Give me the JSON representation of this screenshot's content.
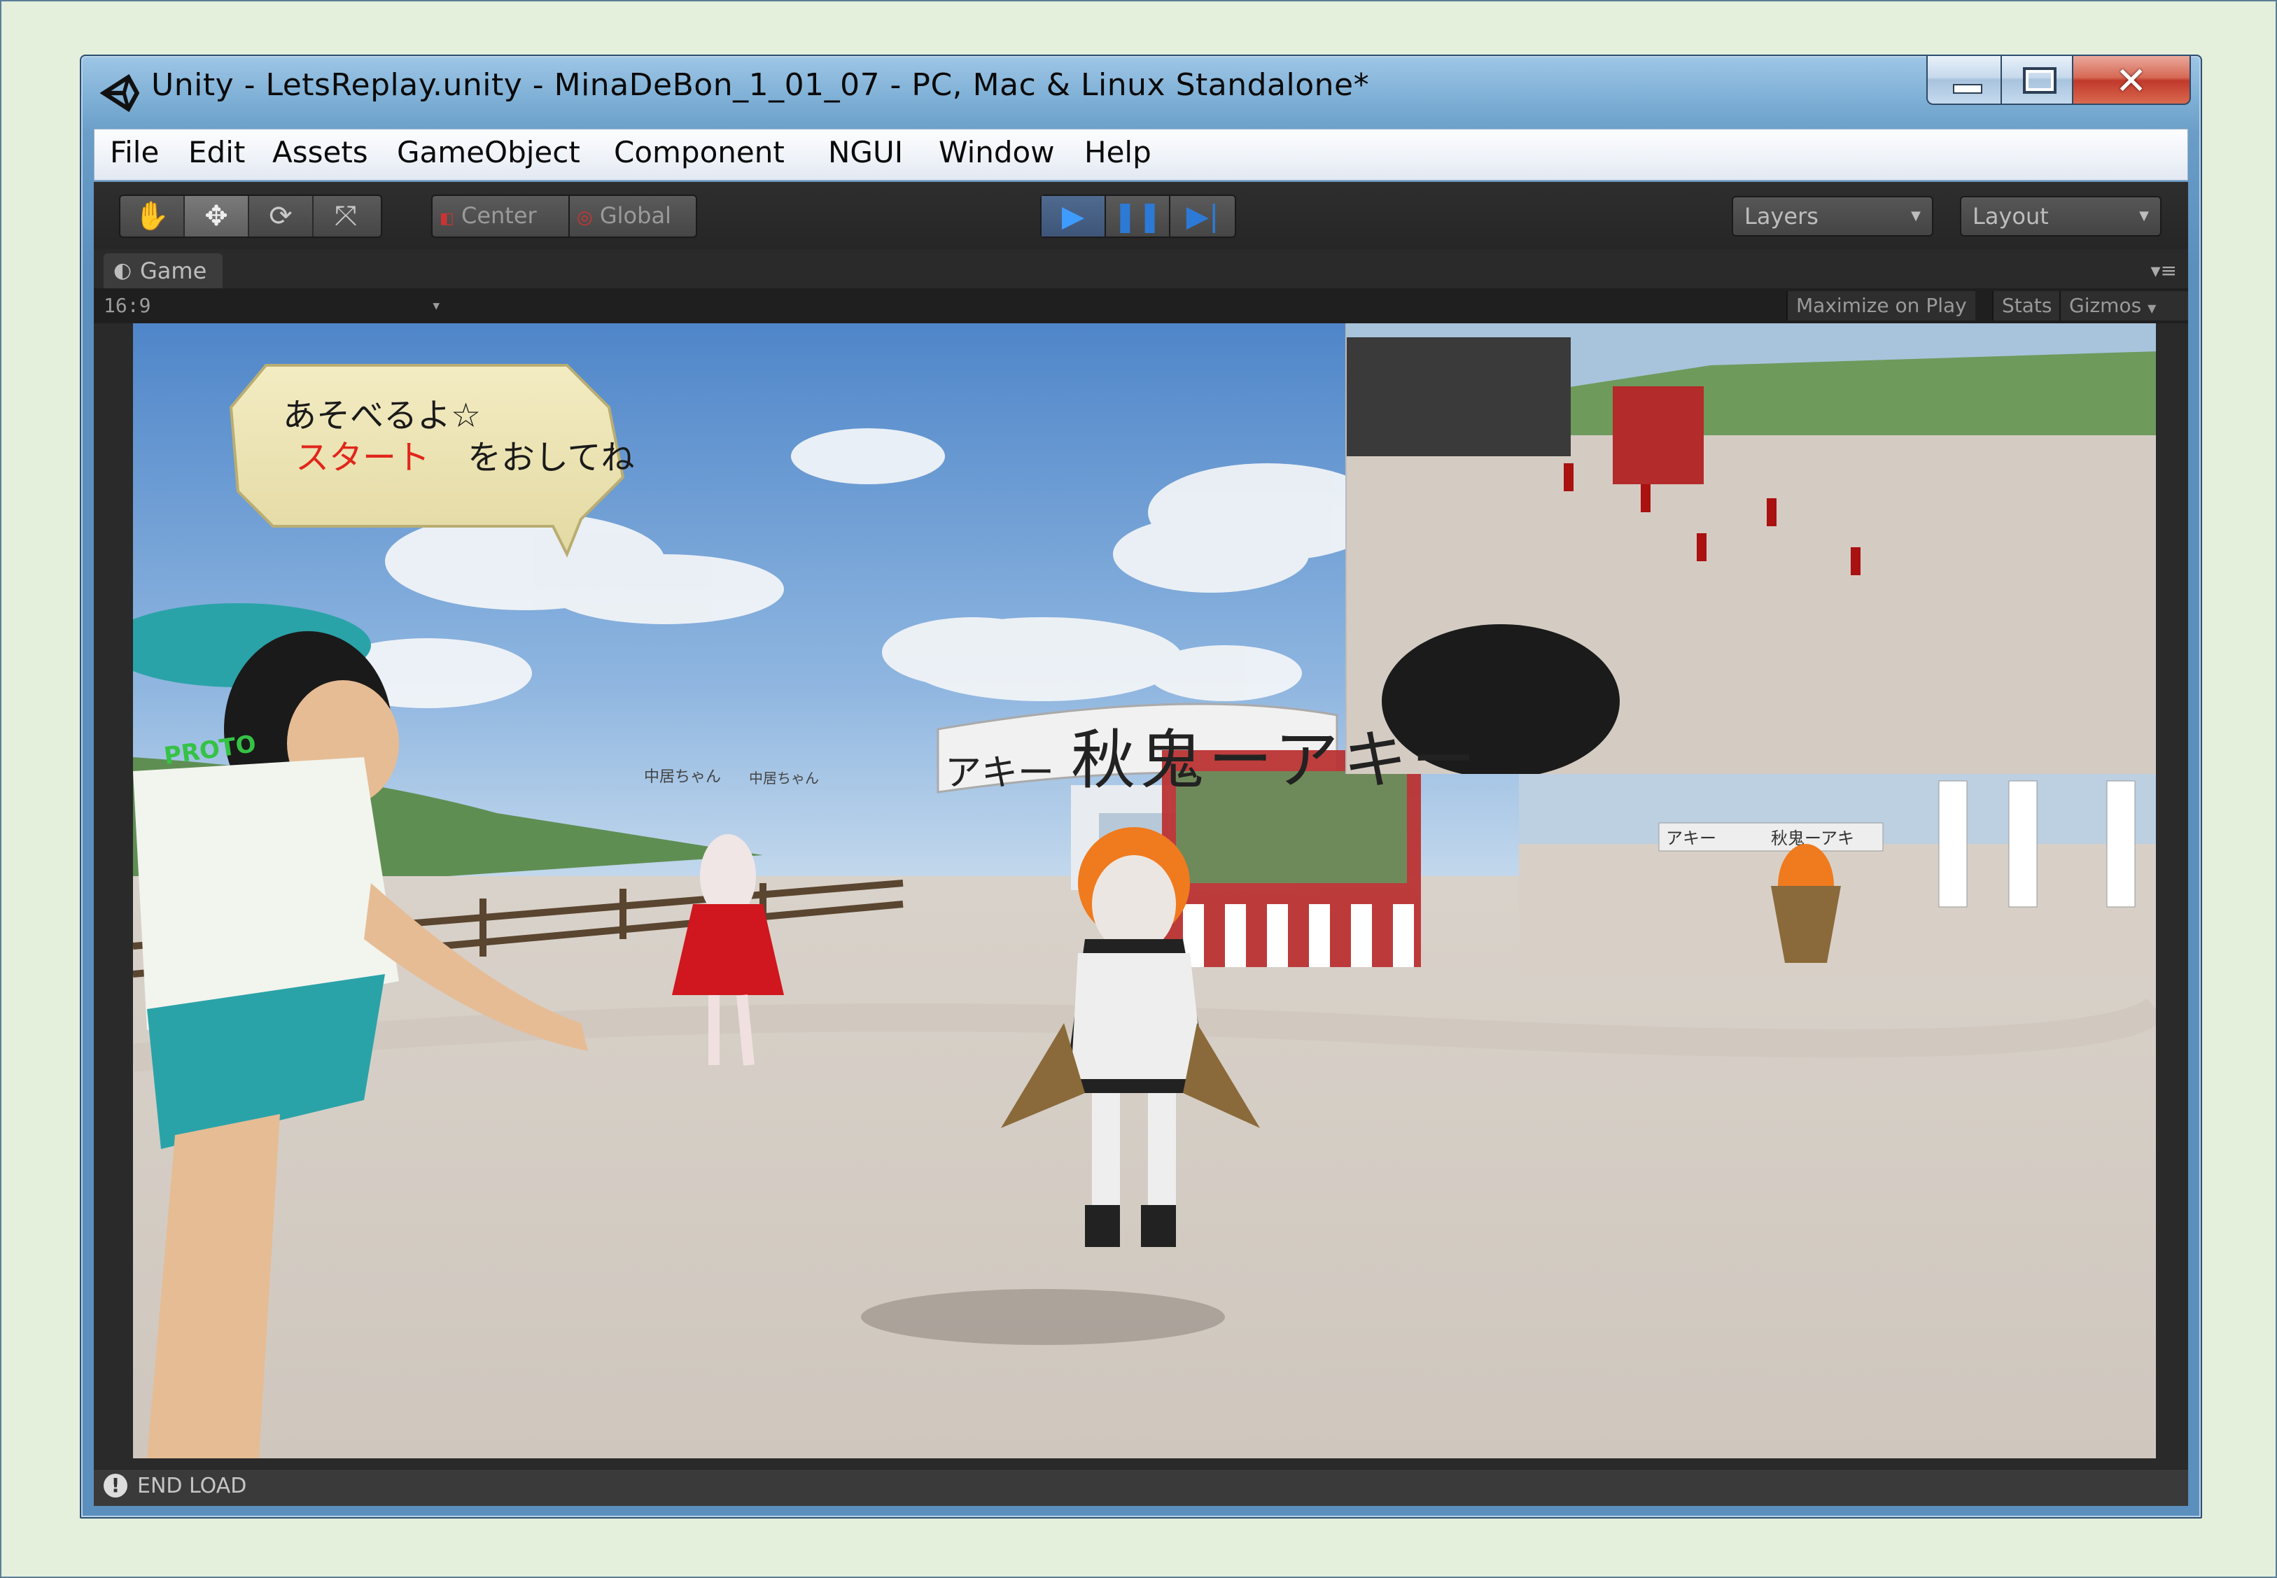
{
  "window": {
    "title": "Unity - LetsReplay.unity - MinaDeBon_1_01_07 - PC, Mac & Linux Standalone*"
  },
  "menu": {
    "items": [
      "File",
      "Edit",
      "Assets",
      "GameObject",
      "Component",
      "NGUI",
      "Window",
      "Help"
    ]
  },
  "toolbar": {
    "tools": [
      "hand-icon",
      "move-icon",
      "rotate-icon",
      "scale-icon"
    ],
    "pivot_center": "Center",
    "pivot_global": "Global",
    "playback": [
      "play-icon",
      "pause-icon",
      "step-icon"
    ],
    "play_active": true,
    "layers_label": "Layers",
    "layout_label": "Layout"
  },
  "game_view": {
    "tab_label": "Game",
    "aspect": "16:9",
    "maximize_on_play": "Maximize on Play",
    "stats": "Stats",
    "gizmos": "Gizmos"
  },
  "scene": {
    "speech_line1": "あそべるよ☆",
    "speech_start": "スタート",
    "speech_line2": "をおしてね",
    "arch_banner": "秋鬼ーアキー",
    "arch_banner_left": "アキー",
    "small_banner": "中居ちゃん",
    "small_banner2": "中居ちゃん",
    "shirt_text": "PROTO",
    "inset_banner1": "アキー",
    "inset_banner2": "秋鬼ーアキ"
  },
  "status": {
    "text": "END LOAD"
  },
  "colors": {
    "editor_dark": "#3a3a3a",
    "play_blue": "#3e9bff",
    "speech_red": "#e0261a",
    "bubble_fill": "#efe6b3",
    "sky": "#5b8fcf"
  }
}
